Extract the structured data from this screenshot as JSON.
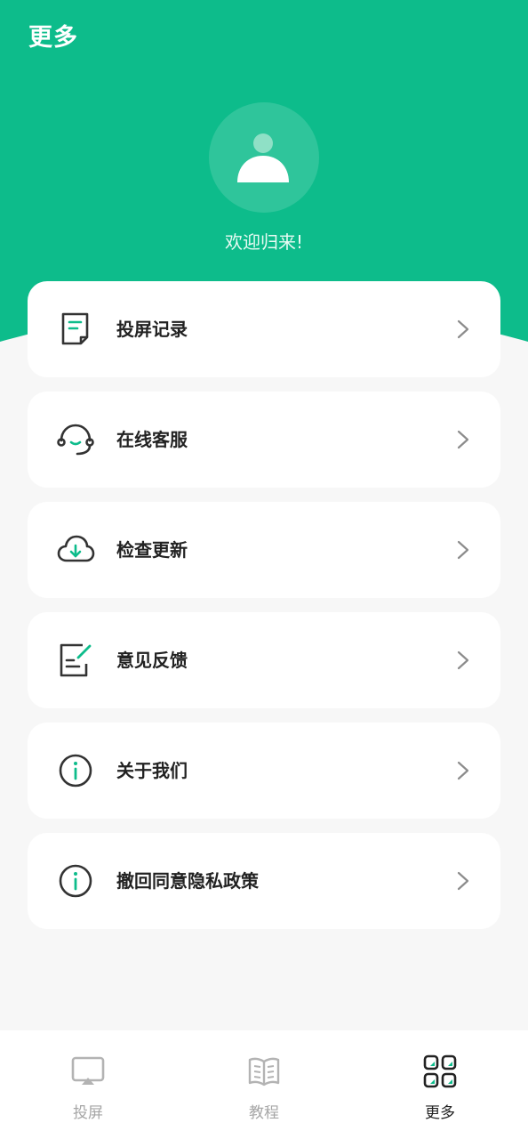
{
  "header": {
    "title": "更多",
    "welcome": "欢迎归来!"
  },
  "colors": {
    "brand_green": "#0dbc8b",
    "text_dark": "#222222",
    "tab_inactive": "#a6a6a6",
    "background": "#f7f7f7"
  },
  "menu": {
    "items": [
      {
        "label": "投屏记录",
        "icon": "document-icon"
      },
      {
        "label": "在线客服",
        "icon": "headset-icon"
      },
      {
        "label": "检查更新",
        "icon": "cloud-download-icon"
      },
      {
        "label": "意见反馈",
        "icon": "feedback-edit-icon"
      },
      {
        "label": "关于我们",
        "icon": "info-icon"
      },
      {
        "label": "撤回同意隐私政策",
        "icon": "info-icon"
      }
    ]
  },
  "tabbar": {
    "tabs": [
      {
        "label": "投屏",
        "icon": "cast-screen-icon",
        "active": false
      },
      {
        "label": "教程",
        "icon": "book-icon",
        "active": false
      },
      {
        "label": "更多",
        "icon": "grid-icon",
        "active": true
      }
    ]
  }
}
